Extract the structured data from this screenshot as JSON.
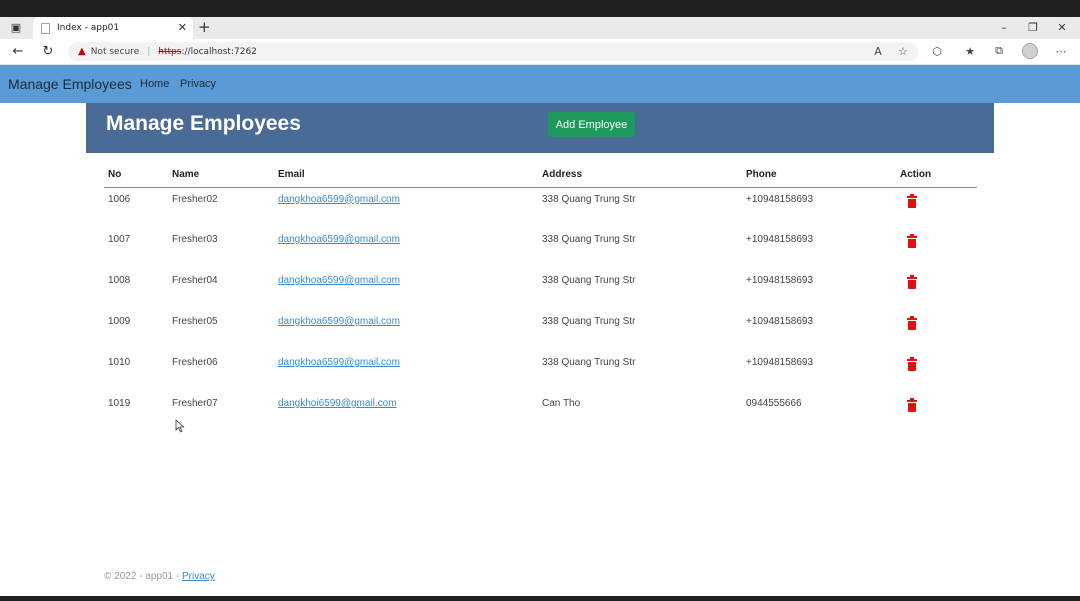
{
  "browser": {
    "tab_title": "Index - app01",
    "tab_close": "✕",
    "new_tab": "+",
    "security_label": "Not secure",
    "url_scheme": "https",
    "url_rest": "://localhost:7262"
  },
  "navbar": {
    "brand": "Manage Employees",
    "links": [
      "Home",
      "Privacy"
    ]
  },
  "header": {
    "title": "Manage Employees",
    "add_button": "Add Employee"
  },
  "table": {
    "columns": [
      "No",
      "Name",
      "Email",
      "Address",
      "Phone",
      "Action"
    ],
    "rows": [
      {
        "no": "1006",
        "name": "Fresher02",
        "email": "dangkhoa6599@gmail.com",
        "address": "338 Quang Trung Str",
        "phone": "+10948158693"
      },
      {
        "no": "1007",
        "name": "Fresher03",
        "email": "dangkhoa6599@gmail.com",
        "address": "338 Quang Trung Str",
        "phone": "+10948158693"
      },
      {
        "no": "1008",
        "name": "Fresher04",
        "email": "dangkhoa6599@gmail.com",
        "address": "338 Quang Trung Str",
        "phone": "+10948158693"
      },
      {
        "no": "1009",
        "name": "Fresher05",
        "email": "dangkhoa6599@gmail.com",
        "address": "338 Quang Trung Str",
        "phone": "+10948158693"
      },
      {
        "no": "1010",
        "name": "Fresher06",
        "email": "dangkhoa6599@gmail.com",
        "address": "338 Quang Trung Str",
        "phone": "+10948158693"
      },
      {
        "no": "1019",
        "name": "Fresher07",
        "email": "dangkhoi6599@gmail.com",
        "address": "Can Tho",
        "phone": "0944555666"
      }
    ]
  },
  "footer": {
    "text": "© 2022 - app01 -",
    "link": "Privacy"
  },
  "icons": {
    "delete": "trash-icon",
    "back": "back-arrow-icon",
    "refresh": "refresh-icon"
  },
  "colors": {
    "navbar": "#5b9bd5",
    "header_panel": "#4a6b96",
    "add_button": "#1e9a5f",
    "delete_icon": "#e01010",
    "link": "#3a8ccf"
  }
}
